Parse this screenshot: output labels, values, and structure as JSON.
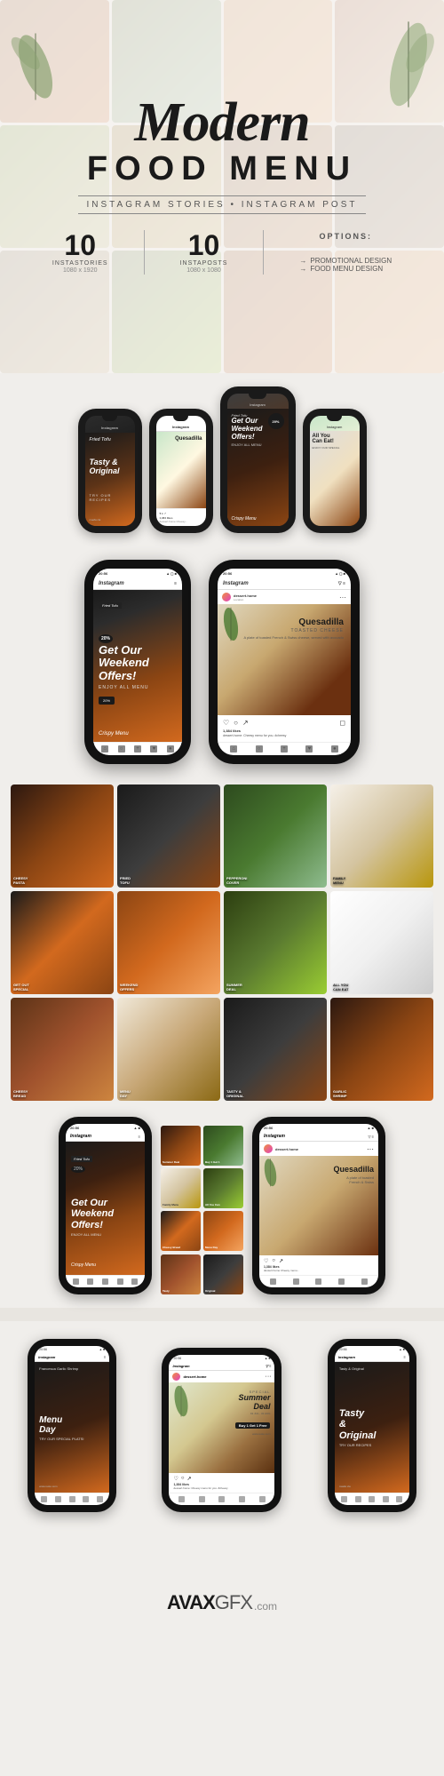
{
  "page": {
    "title": "Modern Food Menu",
    "subtitle": "Instagram Stories • Instagram Post",
    "brand": "AVAXGFX",
    "brand_com": ".com",
    "watermark": "AVAXGFX.com"
  },
  "hero": {
    "title_line1": "Modern",
    "title_line2": "FOOD MENU",
    "subtitle": "Instagram Stories • Instagram Post",
    "stat1_num": "10",
    "stat1_label": "INSTASTORIES",
    "stat1_size": "1080 x 1920",
    "stat2_num": "10",
    "stat2_label": "INSTAPOSTS",
    "stat2_size": "1080 x 1080",
    "options_title": "Options:",
    "option1": "PROMOTIONAL DESIGN",
    "option2": "FOOD MENU DESIGN"
  },
  "phones": {
    "story_labels": [
      "Fried Tofu",
      "Tasty & Original",
      "Weekend Offers",
      "Family Menu"
    ],
    "post_labels": [
      "Quesadilla",
      "Summer Deal",
      "Buy 1 Get 1 Free",
      "All You Can Eat"
    ]
  },
  "templates": {
    "labels": [
      "CHEESY PASTA",
      "FRIED TOFU",
      "PEPPERONI COVER",
      "FAMILY MENU",
      "GET OUT SPECIAL",
      "WEEKEND OFFERS",
      "SUMMER DEAL",
      "ALL YOU CAN EAT",
      "CHEESY BREAD",
      "MENU DAY",
      "TASTY & ORIGINAL",
      "FRANCESCA GARLIC SHRIMP"
    ]
  },
  "instagram": {
    "user": "dessert.home",
    "time": "20:56",
    "likes": "1,384 likes",
    "caption": "dessert.home: Cheesy menu for you. #cheesy",
    "description": "A plate of toasted French & Swiss cheese, served with avocado",
    "product": "Quesadilla",
    "product_sub": "TOASTED CHEESE"
  },
  "avax": {
    "logo": "AVAX",
    "gfx": "GFX",
    "com": ".com"
  }
}
